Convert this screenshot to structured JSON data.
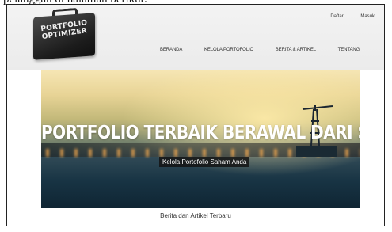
{
  "page_caption": "pelanggan di halaman berikut:",
  "logo": {
    "line1": "PORTFOLIO",
    "line2": "OPTIMIZER"
  },
  "auth": {
    "register": "Daftar",
    "login": "Masuk"
  },
  "nav": {
    "items": [
      {
        "label": "BERANDA"
      },
      {
        "label": "KELOLA PORTOFOLIO"
      },
      {
        "label": "BERITA & ARTIKEL"
      },
      {
        "label": "TENTANG"
      }
    ]
  },
  "hero": {
    "headline": "PORTFOLIO TERBAIK BERAWAL DARI SINI",
    "cta": "Kelola Portofolio Saham Anda"
  },
  "section": {
    "title": "Berita dan Artikel Terbaru"
  }
}
